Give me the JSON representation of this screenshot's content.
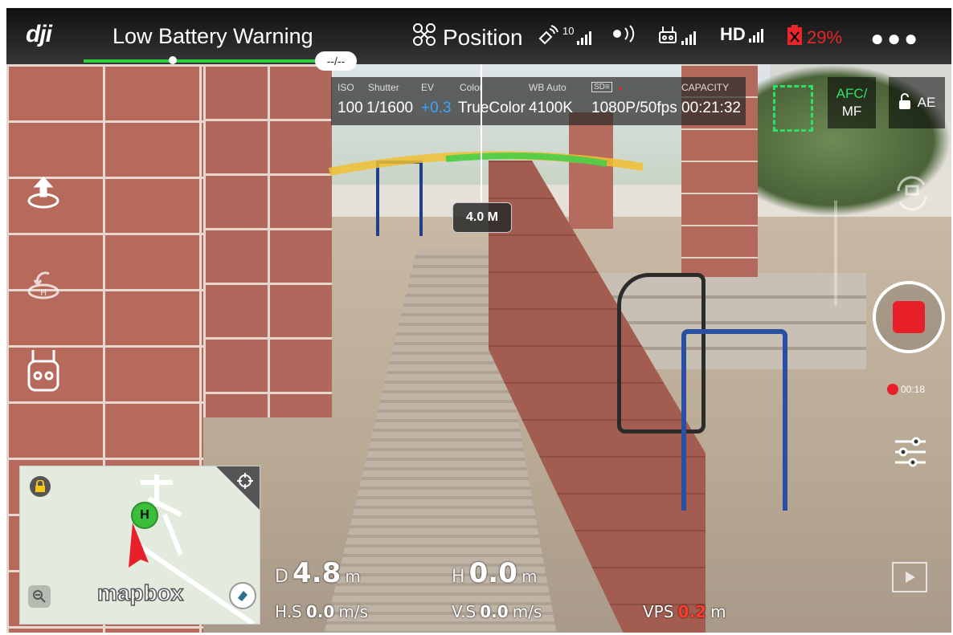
{
  "topbar": {
    "logo": "dji",
    "warning": "Low Battery Warning",
    "warning_progress": 0.38,
    "dash_label": "--/--",
    "flight_mode": "Position",
    "gps_count": "10",
    "rc_label": "",
    "hd_label": "HD",
    "battery_percent": "29%",
    "more_icon": "more-icon"
  },
  "camera": {
    "iso_label": "ISO",
    "iso_value": "100",
    "shutter_label": "Shutter",
    "shutter_value": "1/1600",
    "ev_label": "EV",
    "ev_value": "+0.3",
    "color_label": "Color",
    "color_value": "TrueColor",
    "wb_label": "WB  Auto",
    "wb_value": "4100K",
    "sd_label": "SD",
    "resolution_value": "1080P/50fps",
    "capacity_label": "CAPACITY",
    "capacity_value": "00:21:32",
    "afc_label": "AFC/",
    "mf_label": "MF",
    "ae_label": "AE"
  },
  "overlay": {
    "obstacle_distance": "4.0 M"
  },
  "record": {
    "time": "00:18"
  },
  "map": {
    "home_label": "H",
    "brand": "mapbox"
  },
  "telemetry": {
    "d_label": "D",
    "d_value": "4.8",
    "d_unit": "m",
    "h_label": "H",
    "h_value": "0.0",
    "h_unit": "m",
    "hs_label": "H.S",
    "hs_value": "0.0",
    "hs_unit": "m/s",
    "vs_label": "V.S",
    "vs_value": "0.0",
    "vs_unit": "m/s",
    "vps_label": "VPS",
    "vps_value": "0.2",
    "vps_unit": "m"
  },
  "colors": {
    "accent_green": "#2ee06a",
    "record_red": "#e8202a",
    "battery_red": "#e8262b",
    "ev_blue": "#3aa3ff"
  }
}
